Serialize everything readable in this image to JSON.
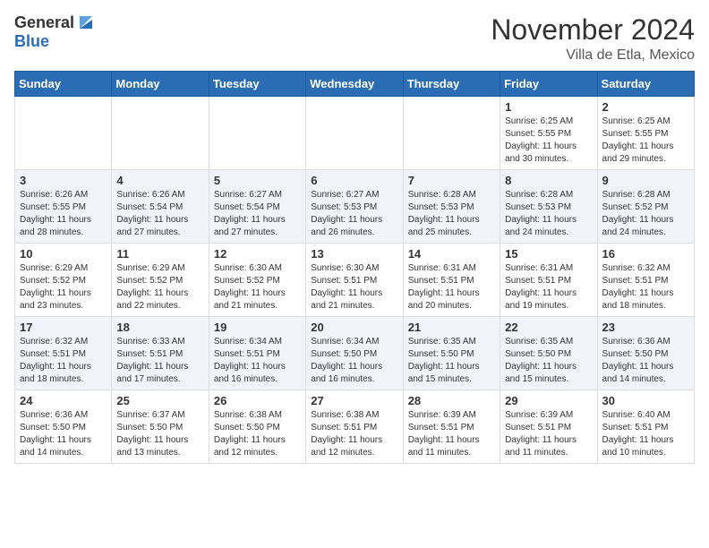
{
  "header": {
    "logo_general": "General",
    "logo_blue": "Blue",
    "month": "November 2024",
    "location": "Villa de Etla, Mexico"
  },
  "weekdays": [
    "Sunday",
    "Monday",
    "Tuesday",
    "Wednesday",
    "Thursday",
    "Friday",
    "Saturday"
  ],
  "weeks": [
    [
      {
        "day": "",
        "info": ""
      },
      {
        "day": "",
        "info": ""
      },
      {
        "day": "",
        "info": ""
      },
      {
        "day": "",
        "info": ""
      },
      {
        "day": "",
        "info": ""
      },
      {
        "day": "1",
        "info": "Sunrise: 6:25 AM\nSunset: 5:55 PM\nDaylight: 11 hours and 30 minutes."
      },
      {
        "day": "2",
        "info": "Sunrise: 6:25 AM\nSunset: 5:55 PM\nDaylight: 11 hours and 29 minutes."
      }
    ],
    [
      {
        "day": "3",
        "info": "Sunrise: 6:26 AM\nSunset: 5:55 PM\nDaylight: 11 hours and 28 minutes."
      },
      {
        "day": "4",
        "info": "Sunrise: 6:26 AM\nSunset: 5:54 PM\nDaylight: 11 hours and 27 minutes."
      },
      {
        "day": "5",
        "info": "Sunrise: 6:27 AM\nSunset: 5:54 PM\nDaylight: 11 hours and 27 minutes."
      },
      {
        "day": "6",
        "info": "Sunrise: 6:27 AM\nSunset: 5:53 PM\nDaylight: 11 hours and 26 minutes."
      },
      {
        "day": "7",
        "info": "Sunrise: 6:28 AM\nSunset: 5:53 PM\nDaylight: 11 hours and 25 minutes."
      },
      {
        "day": "8",
        "info": "Sunrise: 6:28 AM\nSunset: 5:53 PM\nDaylight: 11 hours and 24 minutes."
      },
      {
        "day": "9",
        "info": "Sunrise: 6:28 AM\nSunset: 5:52 PM\nDaylight: 11 hours and 24 minutes."
      }
    ],
    [
      {
        "day": "10",
        "info": "Sunrise: 6:29 AM\nSunset: 5:52 PM\nDaylight: 11 hours and 23 minutes."
      },
      {
        "day": "11",
        "info": "Sunrise: 6:29 AM\nSunset: 5:52 PM\nDaylight: 11 hours and 22 minutes."
      },
      {
        "day": "12",
        "info": "Sunrise: 6:30 AM\nSunset: 5:52 PM\nDaylight: 11 hours and 21 minutes."
      },
      {
        "day": "13",
        "info": "Sunrise: 6:30 AM\nSunset: 5:51 PM\nDaylight: 11 hours and 21 minutes."
      },
      {
        "day": "14",
        "info": "Sunrise: 6:31 AM\nSunset: 5:51 PM\nDaylight: 11 hours and 20 minutes."
      },
      {
        "day": "15",
        "info": "Sunrise: 6:31 AM\nSunset: 5:51 PM\nDaylight: 11 hours and 19 minutes."
      },
      {
        "day": "16",
        "info": "Sunrise: 6:32 AM\nSunset: 5:51 PM\nDaylight: 11 hours and 18 minutes."
      }
    ],
    [
      {
        "day": "17",
        "info": "Sunrise: 6:32 AM\nSunset: 5:51 PM\nDaylight: 11 hours and 18 minutes."
      },
      {
        "day": "18",
        "info": "Sunrise: 6:33 AM\nSunset: 5:51 PM\nDaylight: 11 hours and 17 minutes."
      },
      {
        "day": "19",
        "info": "Sunrise: 6:34 AM\nSunset: 5:51 PM\nDaylight: 11 hours and 16 minutes."
      },
      {
        "day": "20",
        "info": "Sunrise: 6:34 AM\nSunset: 5:50 PM\nDaylight: 11 hours and 16 minutes."
      },
      {
        "day": "21",
        "info": "Sunrise: 6:35 AM\nSunset: 5:50 PM\nDaylight: 11 hours and 15 minutes."
      },
      {
        "day": "22",
        "info": "Sunrise: 6:35 AM\nSunset: 5:50 PM\nDaylight: 11 hours and 15 minutes."
      },
      {
        "day": "23",
        "info": "Sunrise: 6:36 AM\nSunset: 5:50 PM\nDaylight: 11 hours and 14 minutes."
      }
    ],
    [
      {
        "day": "24",
        "info": "Sunrise: 6:36 AM\nSunset: 5:50 PM\nDaylight: 11 hours and 14 minutes."
      },
      {
        "day": "25",
        "info": "Sunrise: 6:37 AM\nSunset: 5:50 PM\nDaylight: 11 hours and 13 minutes."
      },
      {
        "day": "26",
        "info": "Sunrise: 6:38 AM\nSunset: 5:50 PM\nDaylight: 11 hours and 12 minutes."
      },
      {
        "day": "27",
        "info": "Sunrise: 6:38 AM\nSunset: 5:51 PM\nDaylight: 11 hours and 12 minutes."
      },
      {
        "day": "28",
        "info": "Sunrise: 6:39 AM\nSunset: 5:51 PM\nDaylight: 11 hours and 11 minutes."
      },
      {
        "day": "29",
        "info": "Sunrise: 6:39 AM\nSunset: 5:51 PM\nDaylight: 11 hours and 11 minutes."
      },
      {
        "day": "30",
        "info": "Sunrise: 6:40 AM\nSunset: 5:51 PM\nDaylight: 11 hours and 10 minutes."
      }
    ]
  ]
}
